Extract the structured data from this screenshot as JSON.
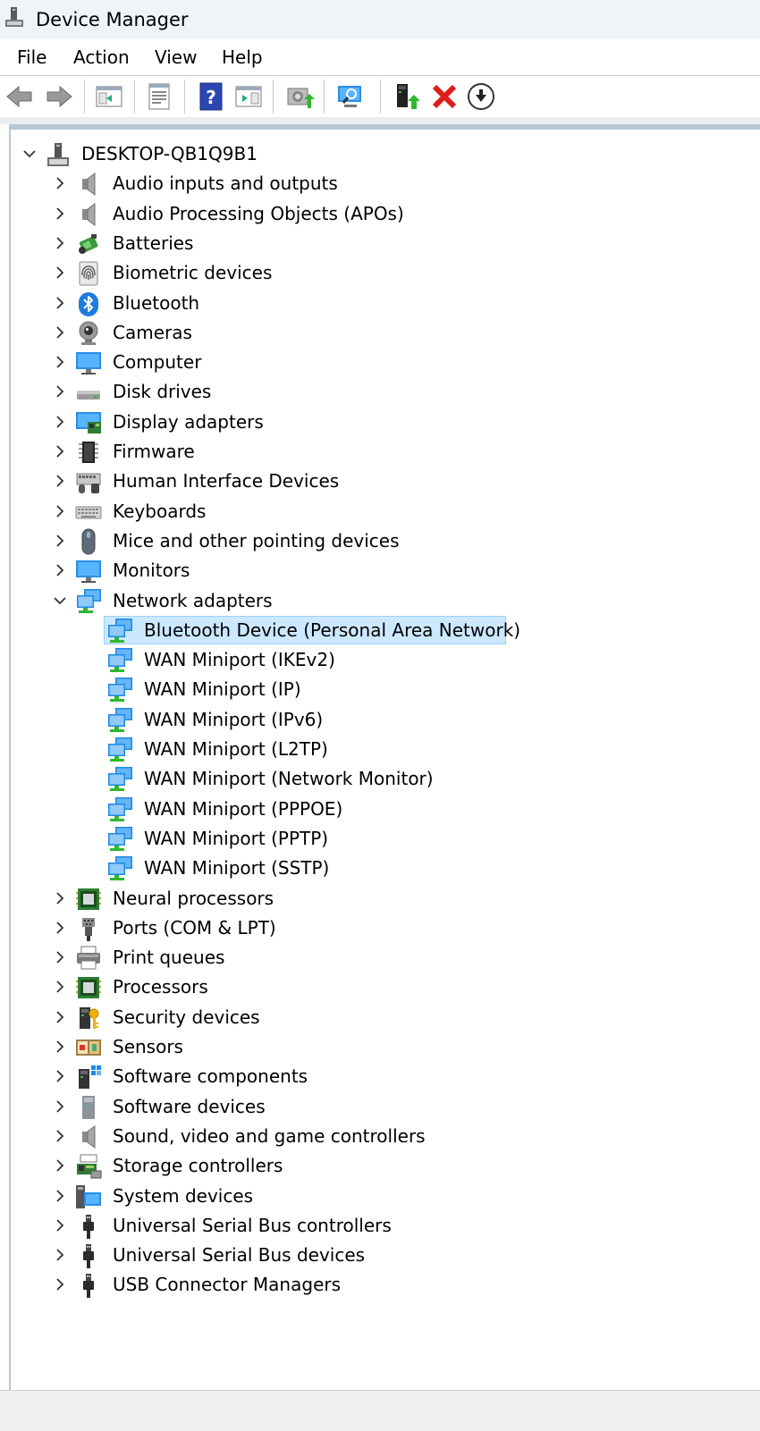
{
  "window": {
    "title": "Device Manager"
  },
  "menu": [
    "File",
    "Action",
    "View",
    "Help"
  ],
  "toolbar": [
    {
      "icon": "back-arrow-icon"
    },
    {
      "icon": "forward-arrow-icon"
    },
    {
      "icon": "show-hide-console-tree-icon"
    },
    {
      "icon": "properties-icon"
    },
    {
      "icon": "help-icon"
    },
    {
      "icon": "action-pane-icon"
    },
    {
      "icon": "update-driver-icon"
    },
    {
      "icon": "scan-hardware-changes-icon"
    },
    {
      "icon": "enable-device-icon"
    },
    {
      "icon": "uninstall-device-icon"
    },
    {
      "icon": "disable-device-icon"
    }
  ],
  "tree": {
    "root": {
      "label": "DESKTOP-QB1Q9B1",
      "icon": "computer-root-icon",
      "expanded": true
    },
    "categories": [
      {
        "label": "Audio inputs and outputs",
        "icon": "speaker-icon",
        "expanded": false
      },
      {
        "label": "Audio Processing Objects (APOs)",
        "icon": "speaker-icon",
        "expanded": false
      },
      {
        "label": "Batteries",
        "icon": "battery-icon",
        "expanded": false
      },
      {
        "label": "Biometric devices",
        "icon": "fingerprint-icon",
        "expanded": false
      },
      {
        "label": "Bluetooth",
        "icon": "bluetooth-icon",
        "expanded": false
      },
      {
        "label": "Cameras",
        "icon": "webcam-icon",
        "expanded": false
      },
      {
        "label": "Computer",
        "icon": "monitor-icon",
        "expanded": false
      },
      {
        "label": "Disk drives",
        "icon": "disk-drive-icon",
        "expanded": false
      },
      {
        "label": "Display adapters",
        "icon": "display-adapter-icon",
        "expanded": false
      },
      {
        "label": "Firmware",
        "icon": "chip-icon",
        "expanded": false
      },
      {
        "label": "Human Interface Devices",
        "icon": "hid-icon",
        "expanded": false
      },
      {
        "label": "Keyboards",
        "icon": "keyboard-icon",
        "expanded": false
      },
      {
        "label": "Mice and other pointing devices",
        "icon": "mouse-icon",
        "expanded": false
      },
      {
        "label": "Monitors",
        "icon": "monitor-icon",
        "expanded": false
      },
      {
        "label": "Network adapters",
        "icon": "network-adapter-icon",
        "expanded": true,
        "children": [
          {
            "label": "Bluetooth Device (Personal Area Network)",
            "icon": "network-adapter-icon",
            "selected": true
          },
          {
            "label": "WAN Miniport (IKEv2)",
            "icon": "network-adapter-icon"
          },
          {
            "label": "WAN Miniport (IP)",
            "icon": "network-adapter-icon"
          },
          {
            "label": "WAN Miniport (IPv6)",
            "icon": "network-adapter-icon"
          },
          {
            "label": "WAN Miniport (L2TP)",
            "icon": "network-adapter-icon"
          },
          {
            "label": "WAN Miniport (Network Monitor)",
            "icon": "network-adapter-icon"
          },
          {
            "label": "WAN Miniport (PPPOE)",
            "icon": "network-adapter-icon"
          },
          {
            "label": "WAN Miniport (PPTP)",
            "icon": "network-adapter-icon"
          },
          {
            "label": "WAN Miniport (SSTP)",
            "icon": "network-adapter-icon"
          }
        ]
      },
      {
        "label": "Neural processors",
        "icon": "processor-icon",
        "expanded": false
      },
      {
        "label": "Ports (COM & LPT)",
        "icon": "port-icon",
        "expanded": false
      },
      {
        "label": "Print queues",
        "icon": "printer-icon",
        "expanded": false
      },
      {
        "label": "Processors",
        "icon": "processor-icon",
        "expanded": false
      },
      {
        "label": "Security devices",
        "icon": "security-key-icon",
        "expanded": false
      },
      {
        "label": "Sensors",
        "icon": "sensor-icon",
        "expanded": false
      },
      {
        "label": "Software components",
        "icon": "software-component-icon",
        "expanded": false
      },
      {
        "label": "Software devices",
        "icon": "software-device-icon",
        "expanded": false
      },
      {
        "label": "Sound, video and game controllers",
        "icon": "speaker-icon",
        "expanded": false
      },
      {
        "label": "Storage controllers",
        "icon": "storage-controller-icon",
        "expanded": false
      },
      {
        "label": "System devices",
        "icon": "system-device-icon",
        "expanded": false
      },
      {
        "label": "Universal Serial Bus controllers",
        "icon": "usb-icon",
        "expanded": false
      },
      {
        "label": "Universal Serial Bus devices",
        "icon": "usb-icon",
        "expanded": false
      },
      {
        "label": "USB Connector Managers",
        "icon": "usb-icon",
        "expanded": false
      }
    ]
  },
  "colors": {
    "selection": "#cce8ff",
    "selection_border": "#99d1ff",
    "accent_blue": "#1e90ff",
    "green": "#2eb82e"
  }
}
